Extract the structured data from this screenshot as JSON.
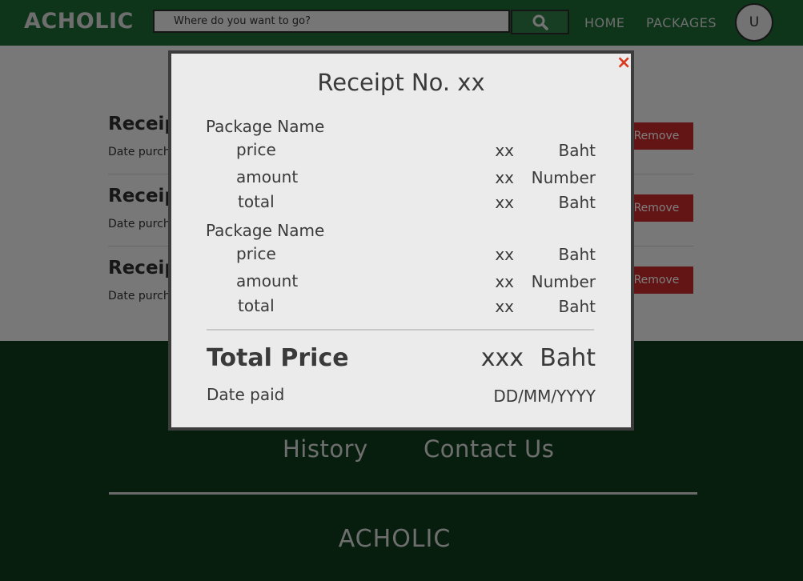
{
  "navbar": {
    "logo": "ACHOLIC",
    "search_placeholder": "Where do you want to go?",
    "links": [
      "HOME",
      "PACKAGES"
    ],
    "avatar_initial": "U"
  },
  "receipts": [
    {
      "title": "Receipt",
      "date": "Date purch",
      "remove": "Remove"
    },
    {
      "title": "Receipt",
      "date": "Date purch",
      "remove": "Remove"
    },
    {
      "title": "Receipt",
      "date": "Date purch",
      "remove": "Remove"
    }
  ],
  "footer": {
    "links": [
      "History",
      "Contact Us"
    ],
    "logo": "ACHOLIC"
  },
  "modal": {
    "close_icon": "×",
    "title": "Receipt No. xx",
    "packages": [
      {
        "name": "Package Name",
        "lines": [
          {
            "label": "price",
            "value": "xx",
            "unit": "Baht"
          },
          {
            "label": "amount",
            "value": "xx",
            "unit": "Number"
          },
          {
            "label": "total",
            "value": "xx",
            "unit": "Baht"
          }
        ]
      },
      {
        "name": "Package Name",
        "lines": [
          {
            "label": "price",
            "value": "xx",
            "unit": "Baht"
          },
          {
            "label": "amount",
            "value": "xx",
            "unit": "Number"
          },
          {
            "label": "total",
            "value": "xx",
            "unit": "Baht"
          }
        ]
      }
    ],
    "total_label": "Total Price",
    "total_value": "xxx",
    "total_unit": "Baht",
    "date_label": "Date paid",
    "date_value": "DD/MM/YYYY"
  },
  "colors": {
    "navbar": "#1d6a35",
    "footer": "#0e3c1d",
    "remove_button": "#c62828",
    "close_icon": "#d9381e"
  },
  "icons": {
    "search_button": "search-icon",
    "close_button": "close-icon"
  }
}
